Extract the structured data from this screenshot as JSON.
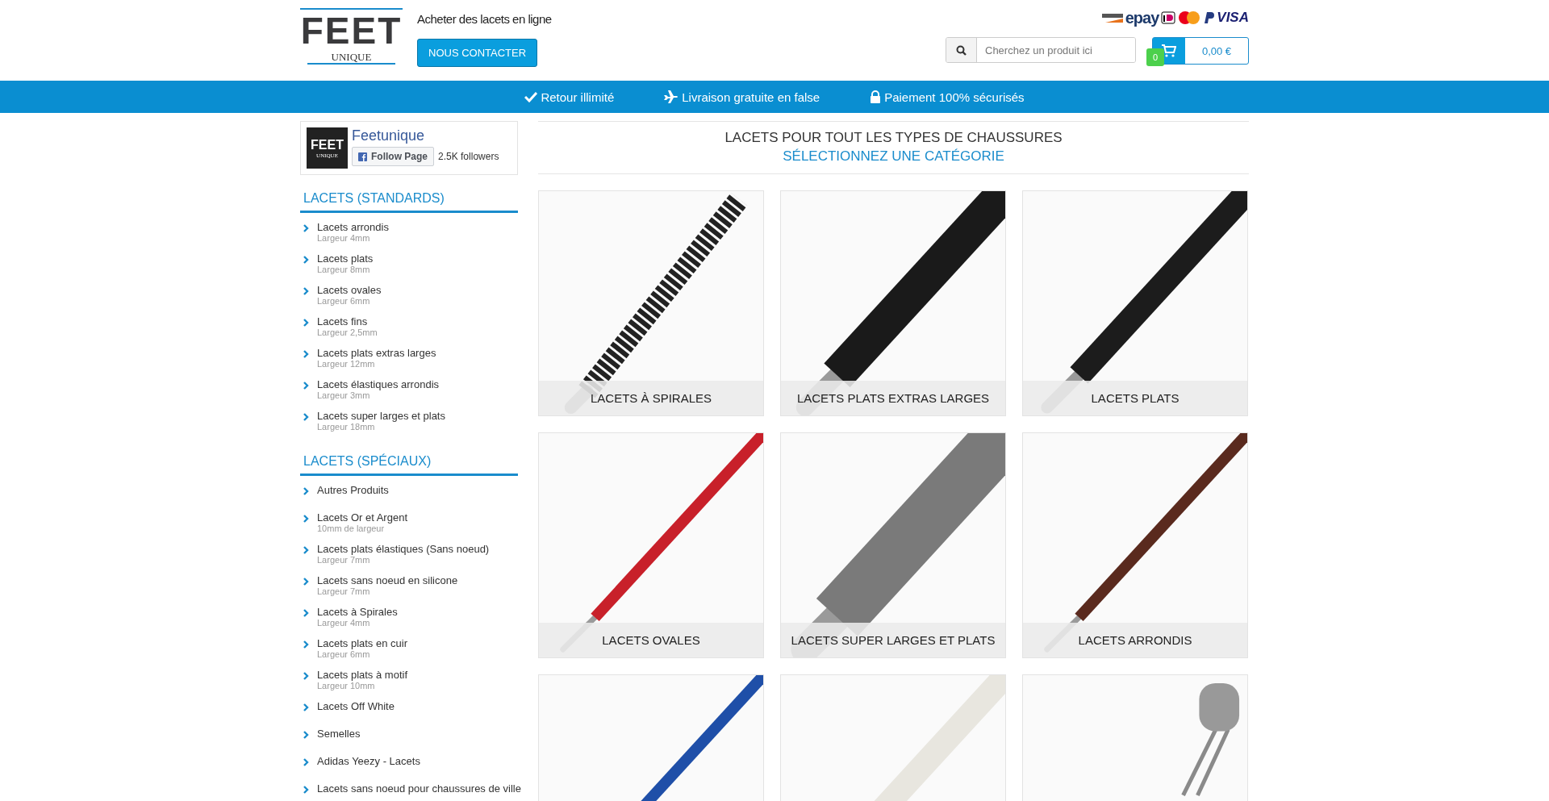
{
  "header": {
    "logo": {
      "title": "FEET",
      "subtitle": "UNIQUE"
    },
    "tagline": "Acheter des lacets en ligne",
    "contact_button": "NOUS CONTACTER",
    "payment_logos": [
      {
        "kind": "discover"
      },
      {
        "kind": "epay",
        "text": "epay"
      },
      {
        "kind": "ideal"
      },
      {
        "kind": "mastercard"
      },
      {
        "kind": "paypal"
      },
      {
        "kind": "visa",
        "text": "VISA"
      }
    ],
    "search": {
      "placeholder": "Cherchez un produit ici"
    },
    "cart": {
      "count": "0",
      "total": "0,00 €"
    }
  },
  "features": [
    {
      "kind": "check",
      "label": "Retour illimité"
    },
    {
      "kind": "plane",
      "label": "Livraison gratuite en false"
    },
    {
      "kind": "lock",
      "label": "Paiement 100% sécurisés"
    }
  ],
  "facebook": {
    "logo_title": "FEET",
    "logo_subtitle": "UNIQUE",
    "page_name": "Feetunique",
    "follow_button": "Follow Page",
    "followers": "2.5K followers"
  },
  "sidebar": [
    {
      "heading": "LACETS (STANDARDS)",
      "items": [
        {
          "label": "Lacets arrondis",
          "detail": "Largeur 4mm"
        },
        {
          "label": "Lacets plats",
          "detail": "Largeur 8mm"
        },
        {
          "label": "Lacets ovales",
          "detail": "Largeur 6mm"
        },
        {
          "label": "Lacets fins",
          "detail": "Largeur 2,5mm"
        },
        {
          "label": "Lacets plats extras larges",
          "detail": "Largeur 12mm"
        },
        {
          "label": "Lacets élastiques arrondis",
          "detail": "Largeur 3mm"
        },
        {
          "label": "Lacets super larges et plats",
          "detail": "Largeur 18mm"
        }
      ]
    },
    {
      "heading": "LACETS (SPÉCIAUX)",
      "items": [
        {
          "label": "Autres Produits"
        },
        {
          "label": "Lacets Or et Argent",
          "detail": "10mm de largeur"
        },
        {
          "label": "Lacets plats élastiques (Sans noeud)",
          "detail": "Largeur 7mm"
        },
        {
          "label": "Lacets sans noeud en silicone",
          "detail": "Largeur 7mm"
        },
        {
          "label": "Lacets à Spirales",
          "detail": "Largeur 4mm"
        },
        {
          "label": "Lacets plats en cuir",
          "detail": "Largeur 6mm"
        },
        {
          "label": "Lacets plats à motif",
          "detail": "Largeur 10mm"
        },
        {
          "label": "Lacets Off White"
        },
        {
          "label": "Semelles"
        },
        {
          "label": "Adidas Yeezy - Lacets"
        },
        {
          "label": "Lacets sans noeud pour chaussures de ville"
        }
      ]
    }
  ],
  "main": {
    "title": "LACETS POUR TOUT LES TYPES DE CHAUSSURES",
    "subtitle": "SÉLECTIONNEZ UNE CATÉGORIE"
  },
  "categories": [
    {
      "kind": "spiral",
      "color": "#222222",
      "label": "LACETS À SPIRALES"
    },
    {
      "kind": "wide",
      "color": "#1a1a1a",
      "label": "LACETS PLATS EXTRAS LARGES"
    },
    {
      "kind": "flat",
      "color": "#1c1c1c",
      "label": "LACETS PLATS"
    },
    {
      "kind": "round",
      "color": "#c8202a",
      "label": "LACETS OVALES"
    },
    {
      "kind": "superwide",
      "color": "#7a7a7a",
      "label": "LACETS SUPER LARGES ET PLATS"
    },
    {
      "kind": "round",
      "color": "#5a2a1e",
      "label": "LACETS ARRONDIS"
    },
    {
      "kind": "round",
      "color": "#1f4fa8"
    },
    {
      "kind": "flat",
      "color": "#e8e6df"
    },
    {
      "kind": "toggle",
      "color": "#8a8a8a"
    }
  ]
}
